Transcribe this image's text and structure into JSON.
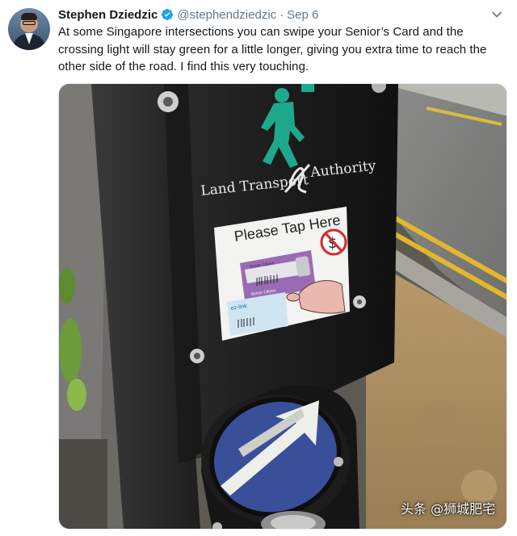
{
  "tweet": {
    "author_name": "Stephen Dziedzic",
    "handle": "@stephendziedzic",
    "separator": "·",
    "timestamp": "Sep 6",
    "text": "At some Singapore intersections you can swipe your Senior’s Card and the crossing light will stay green for a little longer, giving you extra time to reach the other side of the road. I find this very touching.",
    "verified_icon": "verified-badge-icon",
    "menu_icon": "chevron-down-icon"
  },
  "photo": {
    "authority_label_left": "Land Transport",
    "authority_label_right": "Authority",
    "sign_title": "Please Tap Here",
    "card_label_1": "Senior Citizen",
    "card_label_2": "Senior Citizen",
    "card_brand": "ez-link",
    "no_payment_symbol": "$",
    "colors": {
      "signal_green": "#1fa98c",
      "card_purple": "#9a6bb5",
      "pavement_yellow": "#e2b72c",
      "arrow_blue": "#3a4f9a"
    }
  },
  "watermark": "头条 @狮城肥宅"
}
